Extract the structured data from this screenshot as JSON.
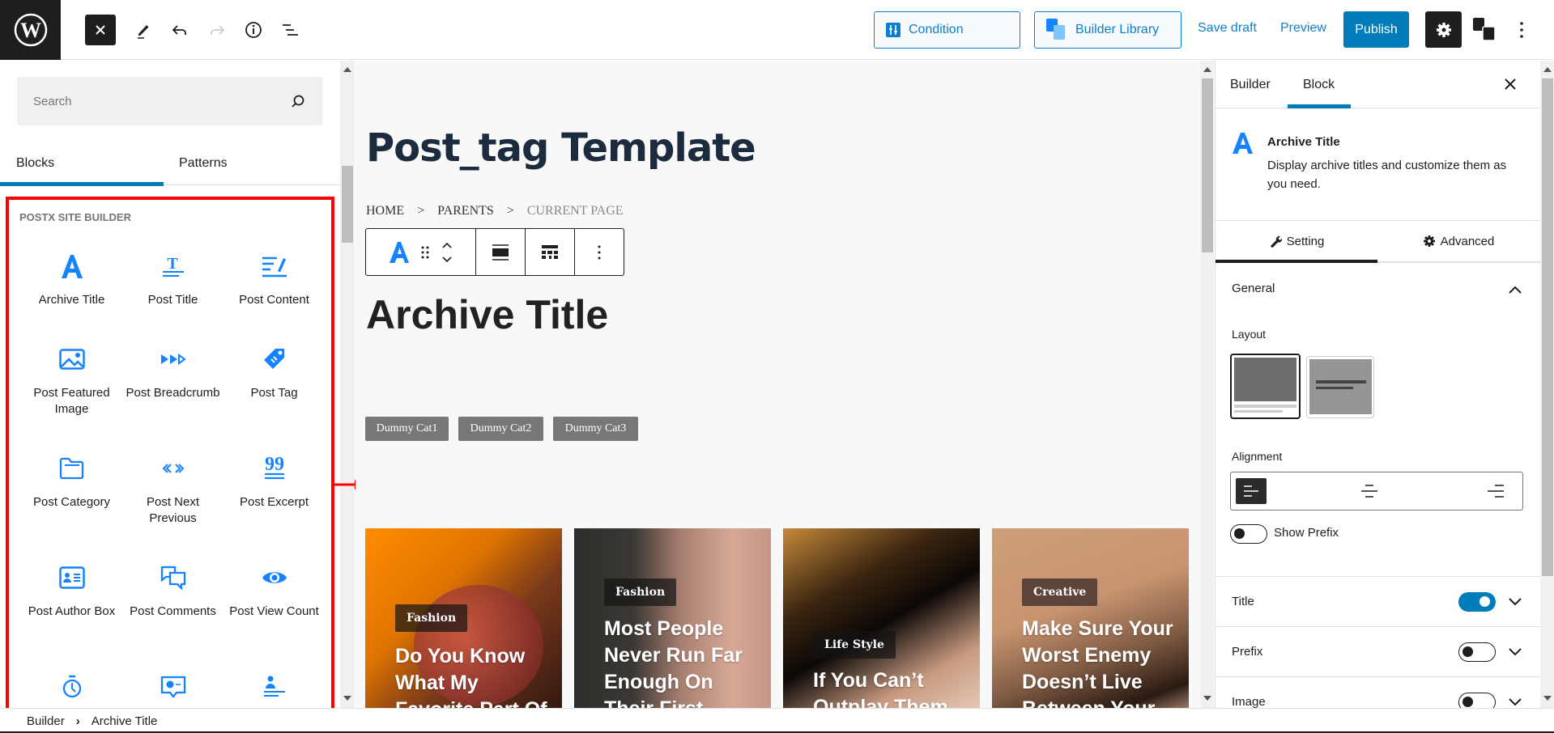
{
  "topbar": {
    "condition_label": "Condition",
    "library_label": "Builder Library",
    "save_draft_label": "Save draft",
    "preview_label": "Preview",
    "publish_label": "Publish"
  },
  "left_panel": {
    "search_placeholder": "Search",
    "tabs": [
      {
        "label": "Blocks",
        "active": true
      },
      {
        "label": "Patterns",
        "active": false
      }
    ],
    "category_label": "POSTX SITE BUILDER",
    "blocks": [
      {
        "label": "Archive Title",
        "icon": "archive-title-icon"
      },
      {
        "label": "Post Title",
        "icon": "post-title-icon"
      },
      {
        "label": "Post Content",
        "icon": "post-content-icon"
      },
      {
        "label": "Post Featured Image",
        "icon": "image-icon"
      },
      {
        "label": "Post Breadcrumb",
        "icon": "breadcrumb-icon"
      },
      {
        "label": "Post Tag",
        "icon": "tag-icon"
      },
      {
        "label": "Post Category",
        "icon": "folder-icon"
      },
      {
        "label": "Post Next Previous",
        "icon": "next-previous-icon"
      },
      {
        "label": "Post Excerpt",
        "icon": "excerpt-icon"
      },
      {
        "label": "Post Author Box",
        "icon": "author-box-icon"
      },
      {
        "label": "Post Comments",
        "icon": "comments-icon"
      },
      {
        "label": "Post View Count",
        "icon": "eye-icon"
      },
      {
        "label": "",
        "icon": "stopwatch-icon"
      },
      {
        "label": "",
        "icon": "chat-bubble-icon"
      },
      {
        "label": "",
        "icon": "author-meta-icon"
      }
    ]
  },
  "canvas": {
    "page_title": "Post_tag Template",
    "breadcrumb": {
      "home": "HOME",
      "sep": ">",
      "parents": "PARENTS",
      "current": "CURRENT PAGE"
    },
    "archive_title": "Archive Title",
    "dummy_cats": [
      "Dummy Cat1",
      "Dummy Cat2",
      "Dummy Cat3"
    ],
    "cards": [
      {
        "category": "Fashion",
        "title": "Do You Know What My Favorite Part Of"
      },
      {
        "category": "Fashion",
        "title": "Most People Never Run Far Enough On Their First"
      },
      {
        "category": "Life Style",
        "title": "If You Can’t Outplay Them"
      },
      {
        "category": "Creative",
        "title": "Make Sure Your Worst Enemy Doesn’t Live Between Your"
      }
    ]
  },
  "right_panel": {
    "tabs": [
      {
        "label": "Builder",
        "active": false
      },
      {
        "label": "Block",
        "active": true
      }
    ],
    "block_name": "Archive Title",
    "block_description": "Display archive titles and customize them as you need.",
    "setting_tabs": [
      {
        "label": "Setting",
        "active": true
      },
      {
        "label": "Advanced",
        "active": false
      }
    ],
    "general_label": "General",
    "layout_label": "Layout",
    "alignment_label": "Alignment",
    "alignment_selected": "left",
    "show_prefix_label": "Show Prefix",
    "show_prefix_on": false,
    "sections": [
      {
        "label": "Title",
        "on": true
      },
      {
        "label": "Prefix",
        "on": false
      },
      {
        "label": "Image",
        "on": false
      }
    ]
  },
  "footer": {
    "crumbs": [
      "Builder",
      "Archive Title"
    ],
    "sep": "›"
  },
  "colors": {
    "accent": "#007cba",
    "block_icon": "#1582ff",
    "highlight": "#ff0000"
  }
}
